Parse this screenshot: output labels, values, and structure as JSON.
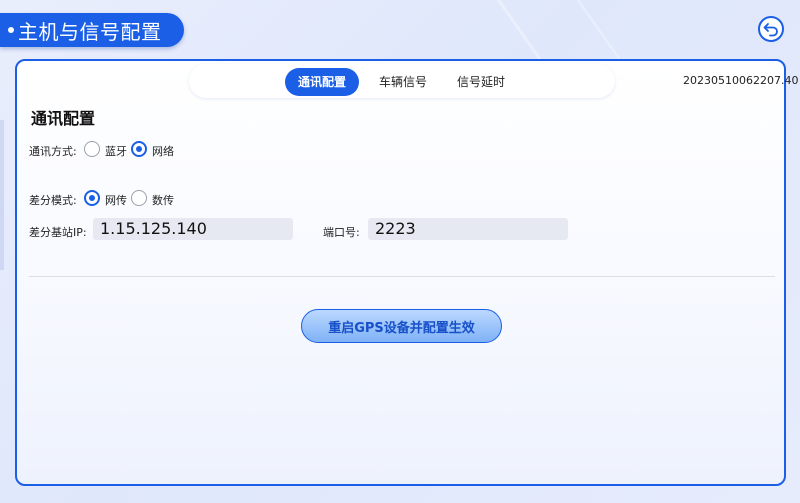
{
  "header": {
    "title": "主机与信号配置"
  },
  "tabs": [
    {
      "label": "通讯配置",
      "active": true
    },
    {
      "label": "车辆信号",
      "active": false
    },
    {
      "label": "信号延时",
      "active": false
    }
  ],
  "timestamp": "20230510062207.40",
  "section": {
    "title": "通讯配置"
  },
  "comm_mode": {
    "label": "通讯方式:",
    "options": [
      {
        "label": "蓝牙",
        "checked": false
      },
      {
        "label": "网络",
        "checked": true
      }
    ]
  },
  "diff_mode": {
    "label": "差分模式:",
    "options": [
      {
        "label": "网传",
        "checked": true
      },
      {
        "label": "数传",
        "checked": false
      }
    ]
  },
  "base_ip": {
    "label": "差分基站IP:",
    "value": "1.15.125.140"
  },
  "port": {
    "label": "端口号:",
    "value": "2223"
  },
  "action": {
    "label": "重启GPS设备并配置生效"
  },
  "colors": {
    "accent": "#1a5fe6",
    "field_bg": "#e6e9f1"
  }
}
